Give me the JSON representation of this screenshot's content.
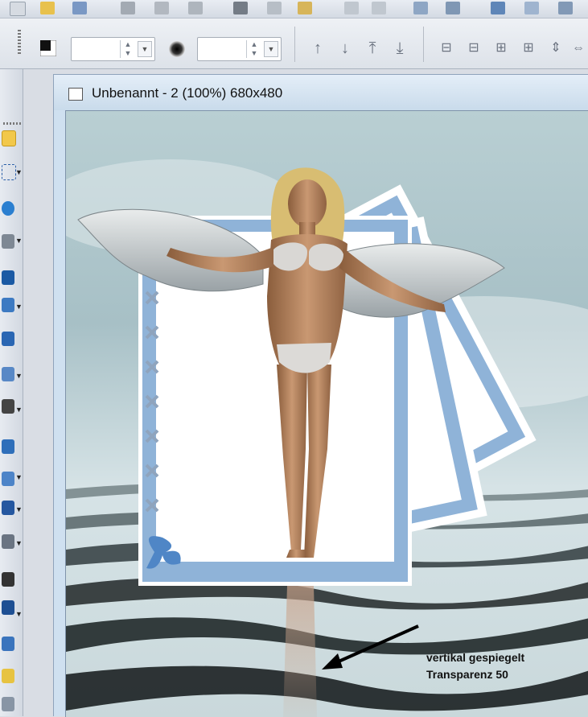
{
  "document": {
    "title": "Unbenannt - 2 (100%) 680x480"
  },
  "annotation": {
    "line1": "vertikal gespiegelt",
    "line2": "Transparenz 50"
  },
  "toolbar": {
    "spin1_value": "",
    "spin2_value": ""
  },
  "colors": {
    "frame_blue": "#8fb3d8",
    "sky": "#a9c2c8",
    "water_dark": "#2b3233"
  }
}
